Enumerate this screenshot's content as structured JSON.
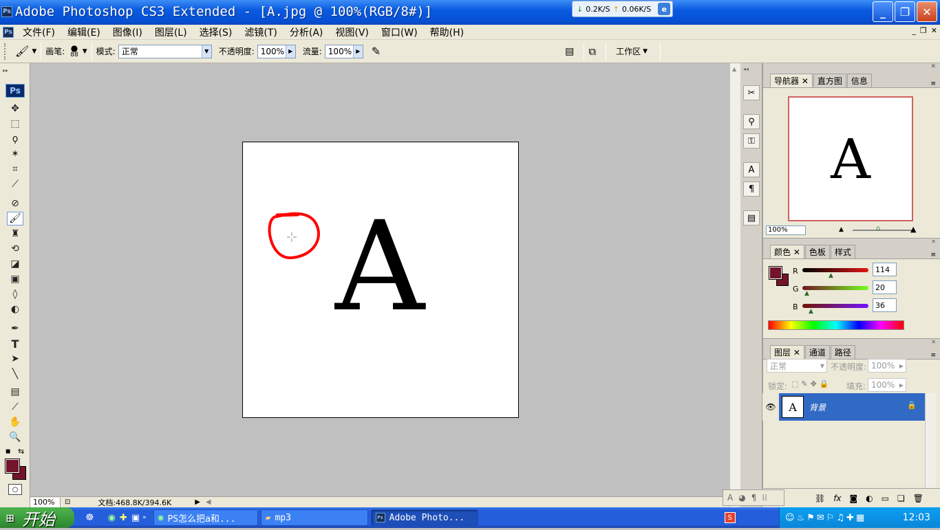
{
  "window": {
    "title": "Adobe Photoshop CS3 Extended - [A.jpg @ 100%(RGB/8#)]",
    "app_badge": "Ps"
  },
  "netmon": {
    "down": "0.2K/S",
    "up": "0.06K/S"
  },
  "menu": [
    "文件(F)",
    "编辑(E)",
    "图像(I)",
    "图层(L)",
    "选择(S)",
    "滤镜(T)",
    "分析(A)",
    "视图(V)",
    "窗口(W)",
    "帮助(H)"
  ],
  "options": {
    "brush_label": "画笔:",
    "brush_size": "88",
    "mode_label": "模式:",
    "mode_value": "正常",
    "opacity_label": "不透明度:",
    "opacity_value": "100%",
    "flow_label": "流量:",
    "flow_value": "100%",
    "workspace": "工作区"
  },
  "canvas": {
    "letter": "A"
  },
  "status": {
    "zoom": "100%",
    "doc": "文档:468.8K/394.6K"
  },
  "navigator": {
    "tabs": [
      "导航器",
      "直方图",
      "信息"
    ],
    "zoom": "100%",
    "letter": "A"
  },
  "color": {
    "tabs": [
      "颜色",
      "色板",
      "样式"
    ],
    "r_label": "R",
    "g_label": "G",
    "b_label": "B",
    "r": "114",
    "g": "20",
    "b": "36",
    "fg": "#72142a"
  },
  "layers": {
    "tabs": [
      "图层",
      "通道",
      "路径"
    ],
    "blend": "正常",
    "opacity_label": "不透明度:",
    "opacity": "100%",
    "lock_label": "锁定:",
    "fill_label": "填充:",
    "fill": "100%",
    "layer_name": "背景",
    "thumb_letter": "A"
  },
  "taskbar": {
    "start": "开始",
    "tasks": [
      "PS怎么把a和...",
      "mp3",
      "Adobe Photo..."
    ],
    "clock": "12:03"
  }
}
